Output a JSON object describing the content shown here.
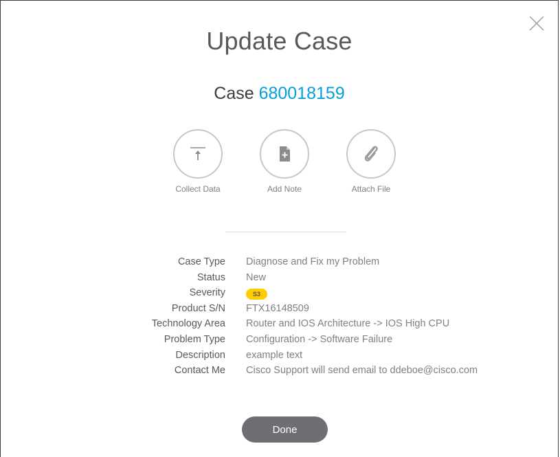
{
  "dialog": {
    "title": "Update Case",
    "case_prefix": "Case",
    "case_number": "680018159",
    "close_icon": "close-icon"
  },
  "actions": [
    {
      "label": "Collect Data",
      "icon": "upload-icon"
    },
    {
      "label": "Add Note",
      "icon": "note-add-icon"
    },
    {
      "label": "Attach File",
      "icon": "paperclip-icon"
    }
  ],
  "details": {
    "case_type": {
      "label": "Case Type",
      "value": "Diagnose and Fix my Problem"
    },
    "status": {
      "label": "Status",
      "value": "New"
    },
    "severity": {
      "label": "Severity",
      "value": "S3"
    },
    "product_sn": {
      "label": "Product S/N",
      "value": "FTX16148509"
    },
    "technology_area": {
      "label": "Technology Area",
      "value": "Router and IOS Architecture -> IOS High CPU"
    },
    "problem_type": {
      "label": "Problem Type",
      "value": "Configuration -> Software Failure"
    },
    "description": {
      "label": "Description",
      "value": "example text"
    },
    "contact_me": {
      "label": "Contact Me",
      "value": "Cisco Support will send email to ddeboe@cisco.com"
    }
  },
  "footer": {
    "done_label": "Done"
  },
  "colors": {
    "accent": "#049fd9",
    "severity_badge": "#ffcc00",
    "button": "#6e6e73"
  }
}
